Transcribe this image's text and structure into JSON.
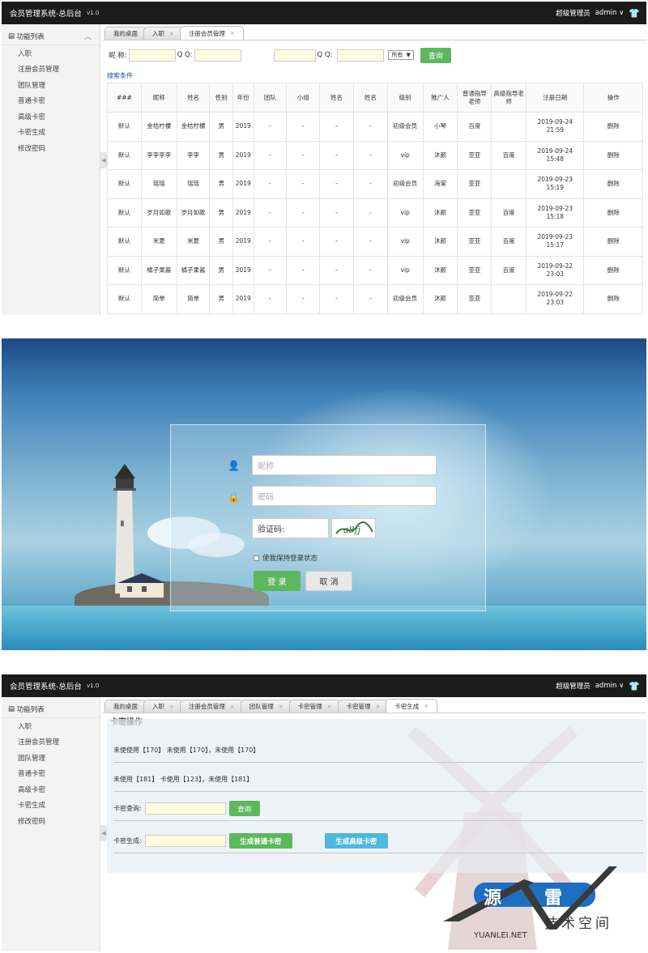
{
  "app": {
    "title": "会员管理系统-总后台",
    "version": "v1.0",
    "user_role": "超级管理员",
    "username": "admin"
  },
  "sidebar": {
    "header": "功能列表",
    "items": [
      "入职",
      "注册会员管理",
      "团队管理",
      "普通卡密",
      "高级卡密",
      "卡密生成",
      "修改密码"
    ]
  },
  "screen1": {
    "tabs": [
      {
        "label": "我的桌面"
      },
      {
        "label": "入职"
      },
      {
        "label": "注册会员管理"
      }
    ],
    "search": {
      "nickname_label": "昵 称:",
      "qq_label1": "Q Q:",
      "qq_label2": "Q Q:",
      "select_value": "所有",
      "query_button": "查询",
      "conditions_label": "搜索条件"
    },
    "table": {
      "headers": [
        "###",
        "昵称",
        "姓名",
        "性别",
        "年份",
        "团队",
        "小组",
        "姓名",
        "姓名",
        "级别",
        "推广人",
        "普通指导老师",
        "高级指导老师",
        "注册日期",
        "操作"
      ],
      "rows": [
        [
          "默认",
          "金桔柠檬",
          "金桔柠檬",
          "男",
          "2019",
          "-",
          "-",
          "-",
          "-",
          "初级会员",
          "小琴",
          "百度",
          "",
          "2019-09-24 21:59",
          "删除"
        ],
        [
          "默认",
          "李李李李",
          "李李",
          "男",
          "2019",
          "-",
          "-",
          "-",
          "-",
          "vip",
          "沐颜",
          "亚亚",
          "百度",
          "2019-09-24 15:48",
          "删除"
        ],
        [
          "默认",
          "瑶瑶",
          "瑶瑶",
          "男",
          "2019",
          "-",
          "-",
          "-",
          "-",
          "初级会员",
          "海棠",
          "亚亚",
          "",
          "2019-09-23 15:19",
          "删除"
        ],
        [
          "默认",
          "岁月如歌",
          "岁月如歌",
          "男",
          "2019",
          "-",
          "-",
          "-",
          "-",
          "vip",
          "沐颜",
          "亚亚",
          "百度",
          "2019-09-23 15:18",
          "删除"
        ],
        [
          "默认",
          "米夏",
          "米夏",
          "男",
          "2019",
          "-",
          "-",
          "-",
          "-",
          "vip",
          "沐颜",
          "亚亚",
          "百度",
          "2019-09-23 15:17",
          "删除"
        ],
        [
          "默认",
          "橘子果酱",
          "橘子果酱",
          "男",
          "2019",
          "-",
          "-",
          "-",
          "-",
          "vip",
          "沐颜",
          "亚亚",
          "百度",
          "2019-09-22 23:03",
          "删除"
        ],
        [
          "默认",
          "简单",
          "简单",
          "男",
          "2019",
          "-",
          "-",
          "-",
          "-",
          "初级会员",
          "沐颜",
          "亚亚",
          "",
          "2019-09-22 23:03",
          "删除"
        ]
      ]
    }
  },
  "screen2": {
    "nickname_placeholder": "昵称",
    "password_placeholder": "密码",
    "captcha_label": "验证码:",
    "captcha_text": "a8fj",
    "remember_label": "使我保持登录状态",
    "login_button": "登 录",
    "cancel_button": "取 消"
  },
  "screen3": {
    "tabs": [
      {
        "label": "我的桌面"
      },
      {
        "label": "入职"
      },
      {
        "label": "注册会员管理"
      },
      {
        "label": "团队管理"
      },
      {
        "label": "卡密管理"
      },
      {
        "label": "卡密管理"
      },
      {
        "label": "卡密生成"
      }
    ],
    "section_title": "卡密操作",
    "line1": "未使使用【170】        未使用【170】，未使用【170】",
    "line2": "未使用【181】              卡使用【123】，未使用【181】",
    "query_label": "卡密查询:",
    "query_button": "查询",
    "generate_label": "卡密生成:",
    "gen_normal_button": "生成普通卡密",
    "gen_advanced_button": "生成高级卡密"
  },
  "watermark": {
    "char1": "源",
    "char2": "雷",
    "subtitle": "技术空间",
    "site": "YUANLEI.NET"
  }
}
